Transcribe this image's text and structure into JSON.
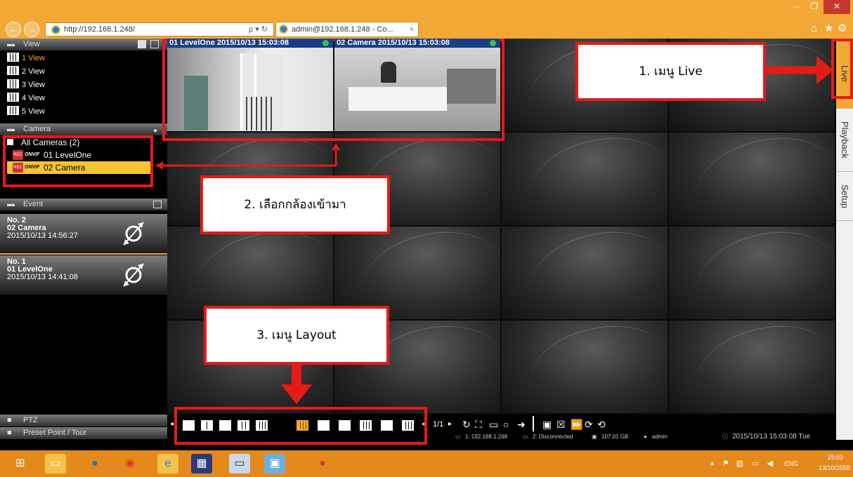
{
  "browser": {
    "url": "http://192.168.1.248/",
    "tab_title": "admin@192.168.1.248 - Co...",
    "search_glyph": "ρ ▾ ↻"
  },
  "sidebar": {
    "view_header": "View",
    "views": [
      "1 View",
      "2 View",
      "3 View",
      "4 View",
      "5 View"
    ],
    "camera_header": "Camera",
    "camera_group": "All Cameras (2)",
    "cameras": [
      "01 LevelOne",
      "02 Camera"
    ],
    "event_header": "Event",
    "events": [
      {
        "no": "No. 2",
        "name": "02 Camera",
        "time": "2015/10/13 14:56:27"
      },
      {
        "no": "No. 1",
        "name": "01 LevelOne",
        "time": "2015/10/13 14:41:08"
      }
    ],
    "ptz_label": "PTZ",
    "preset_label": "Preset Point / Tour"
  },
  "video": {
    "cam1_title": "01 LevelOne   2015/10/13 15:03:08",
    "cam2_title": "02 Camera   2015/10/13 15:03:08"
  },
  "right_tabs": [
    "Live",
    "Playback",
    "Setup"
  ],
  "toolbar": {
    "page": "1/1",
    "ip_status": "1: 192.168.1.248",
    "disc_status": "2: Disconnected",
    "disk": "107.01 GB",
    "user": "admin",
    "datetime": "2015/10/13 15:03:08 Tue"
  },
  "annotations": {
    "a1": "1. เมนู Live",
    "a2": "2. เลือกกล้องเข้ามา",
    "a3": "3. เมนู Layout"
  },
  "taskbar": {
    "lang": "ENG",
    "time": "15:03",
    "date": "13/10/2558"
  },
  "colors": {
    "accent": "#f3a836",
    "annotation": "#e41b17",
    "selected": "#f5c431"
  }
}
